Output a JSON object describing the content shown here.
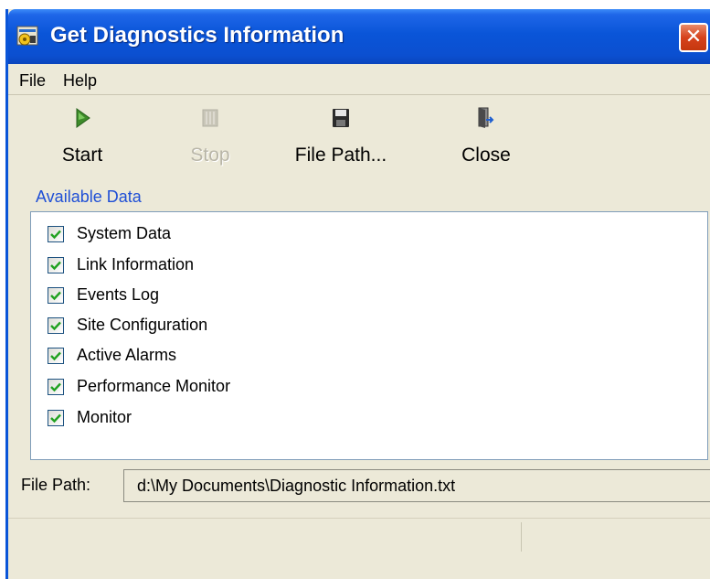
{
  "window": {
    "title": "Get Diagnostics Information",
    "close_glyph": "✕",
    "app_icon": "diagnostics-app-icon"
  },
  "menu": {
    "items": [
      {
        "label": "File"
      },
      {
        "label": "Help"
      }
    ]
  },
  "toolbar": {
    "start": {
      "label": "Start",
      "icon": "play-arrow-icon",
      "enabled": true
    },
    "stop": {
      "label": "Stop",
      "icon": "stop-icon",
      "enabled": false
    },
    "file_path": {
      "label": "File Path...",
      "icon": "floppy-disk-icon",
      "enabled": true
    },
    "close": {
      "label": "Close",
      "icon": "exit-door-icon",
      "enabled": true
    }
  },
  "available_data": {
    "label": "Available Data",
    "items": [
      {
        "label": "System Data",
        "checked": true
      },
      {
        "label": "Link Information",
        "checked": true
      },
      {
        "label": "Events Log",
        "checked": true
      },
      {
        "label": "Site Configuration",
        "checked": true
      },
      {
        "label": "Active Alarms",
        "checked": true
      },
      {
        "label": "Performance Monitor",
        "checked": true
      },
      {
        "label": "Monitor",
        "checked": true
      }
    ]
  },
  "file_path": {
    "label": "File Path:",
    "value": "d:\\My Documents\\Diagnostic Information.txt"
  },
  "colors": {
    "title_bar": "#0A55D8",
    "window_face": "#ECE9D8",
    "group_label": "#1F4FD6",
    "checkmark": "#21A121",
    "start_icon": "#3E8B2A"
  }
}
